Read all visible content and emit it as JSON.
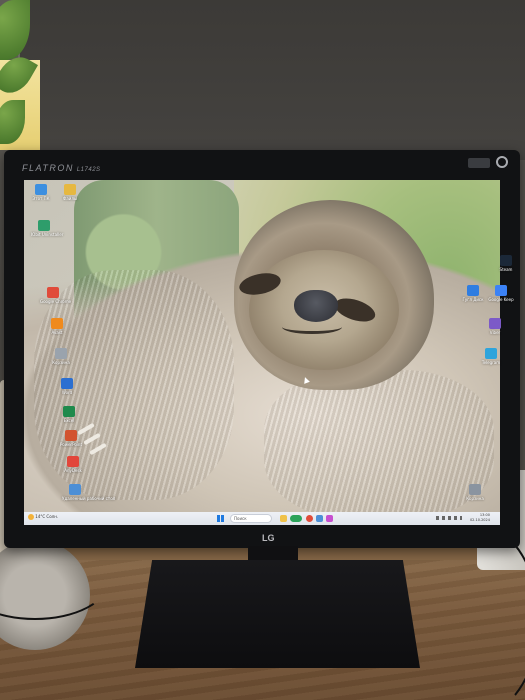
{
  "monitor": {
    "brand": "FLATRON",
    "model": "L1742S",
    "logo": "LG"
  },
  "taskbar": {
    "weather": "14°C Солн.",
    "search_placeholder": "Поиск",
    "clock_time": "13:00",
    "clock_date": "02.10.2024"
  },
  "desktop_icons_left": [
    {
      "label": "Этот ПК",
      "color": "#3c8fe0"
    },
    {
      "label": "Файлы",
      "color": "#e6b840"
    },
    {
      "label": "IObit Uninstaller",
      "color": "#2e9d6b"
    },
    {
      "label": "Google Chrome",
      "color": "#e04b3a"
    },
    {
      "label": "Avast",
      "color": "#f08a1c"
    },
    {
      "label": "Корзина",
      "color": "#9aa3ad"
    },
    {
      "label": "Word",
      "color": "#2b6fd1"
    },
    {
      "label": "Excel",
      "color": "#1f8a4c"
    },
    {
      "label": "PowerPoint",
      "color": "#d2532f"
    },
    {
      "label": "AnyDesk",
      "color": "#e2463a"
    },
    {
      "label": "Удаленный рабочий стол",
      "color": "#4d8fd6"
    }
  ],
  "desktop_icons_right": [
    {
      "label": "Steam",
      "color": "#1b2838"
    },
    {
      "label": "Гугл Диск",
      "color": "#2f7de1"
    },
    {
      "label": "Google Keep",
      "color": "#3b82f6"
    },
    {
      "label": "Viber",
      "color": "#7c5ac8"
    },
    {
      "label": "Telegram",
      "color": "#2ea4dc"
    },
    {
      "label": "Корзина",
      "color": "#8a94a0"
    }
  ]
}
